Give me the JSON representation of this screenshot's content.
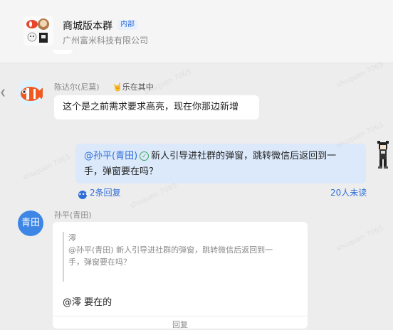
{
  "header": {
    "group_name": "商城版本群",
    "tag": "内部",
    "company": "广州富米科技有限公司"
  },
  "messages": {
    "m1": {
      "sender": "陈达尔(尼莫)",
      "status": "🤘乐在其中",
      "text": "这个是之前需求要求高亮，现在你那边新增"
    },
    "m2": {
      "mention": "@孙平(青田)",
      "text_line1": "新人引导进社群的弹窗，跳转微信后返回到一",
      "text_line2": "手，弹窗要在吗？",
      "reply_count": "2条回复",
      "read_count": "20人未读"
    },
    "m3": {
      "avatar_text": "青田",
      "sender": "孙平(青田)",
      "quote_author": "澪",
      "quote_line1": "@孙平(青田) 新人引导进社群的弹窗，跳转微信后返回到一",
      "quote_line2": "手，弹窗要在吗？",
      "reply_text": "@澪   要在的",
      "footer_label": "回复"
    }
  },
  "watermark": "shuquen 7065",
  "icons": {
    "verified": "check-circle-icon",
    "reply": "reply-icon",
    "scroll": "scroll-left-icon"
  },
  "colors": {
    "accent": "#2f6ed8",
    "my_bubble": "#dbe9fb",
    "background": "#ededed"
  }
}
